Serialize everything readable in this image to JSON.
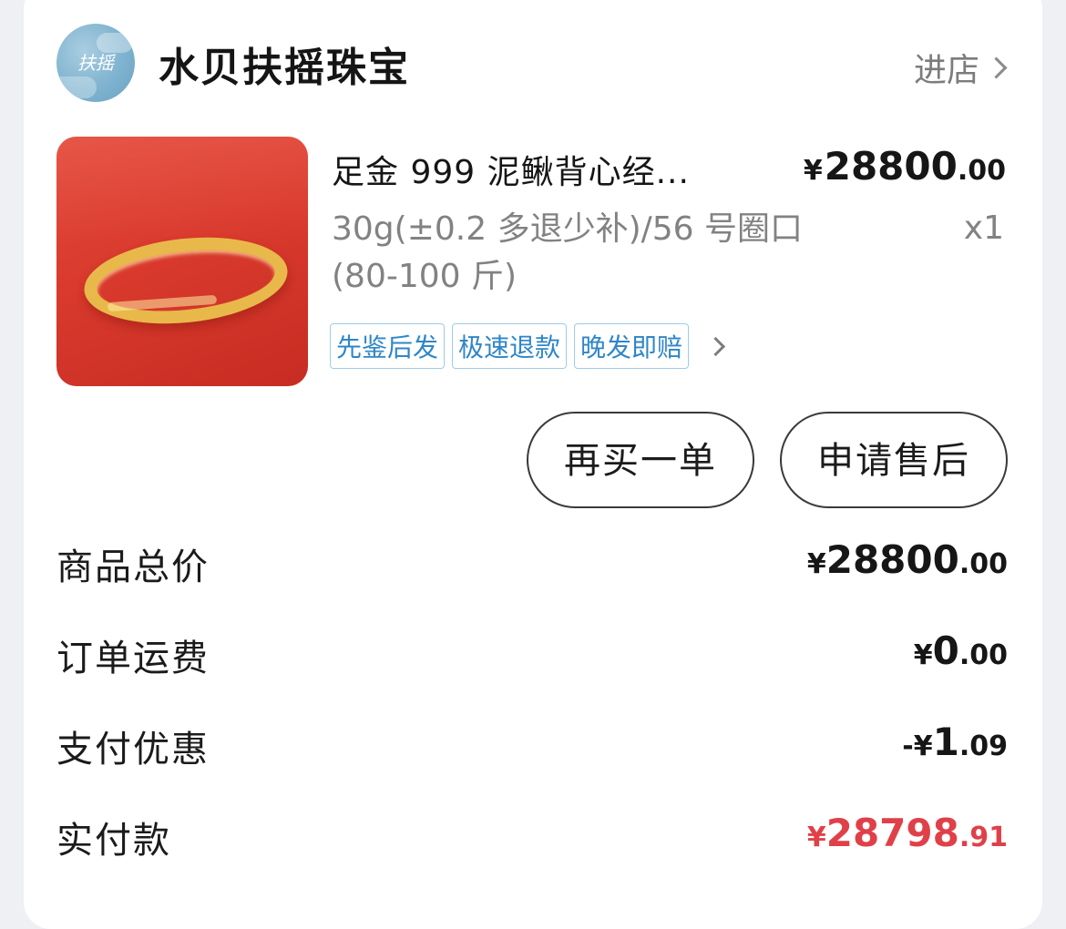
{
  "shop": {
    "avatar_text": "扶摇",
    "name": "水贝扶摇珠宝",
    "enter_label": "进店"
  },
  "product": {
    "title": "足金 999 泥鳅背心经...",
    "price_symbol": "¥",
    "price_int": "28800",
    "price_dec": ".00",
    "spec": "30g(±0.2 多退少补)/56 号圈口 (80-100 斤)",
    "quantity": "x1",
    "tags": [
      "先鉴后发",
      "极速退款",
      "晚发即赔"
    ]
  },
  "actions": {
    "rebuy_label": "再买一单",
    "aftersale_label": "申请售后"
  },
  "summary": {
    "goods_total": {
      "label": "商品总价",
      "prefix": "¥",
      "int": "28800",
      "dec": ".00"
    },
    "shipping": {
      "label": "订单运费",
      "prefix": "¥",
      "int": "0",
      "dec": ".00"
    },
    "discount": {
      "label": "支付优惠",
      "prefix": "-¥",
      "int": "1",
      "dec": ".09"
    },
    "paid": {
      "label": "实付款",
      "prefix": "¥",
      "int": "28798",
      "dec": ".91"
    }
  },
  "colors": {
    "accent_red": "#e04048",
    "tag_blue": "#2f86c8",
    "product_bg_red": "#d93a2d",
    "gold": "#e9b84a"
  },
  "icons": {
    "enter_shop": "chevron-right-icon",
    "tags_more": "chevron-right-icon"
  }
}
